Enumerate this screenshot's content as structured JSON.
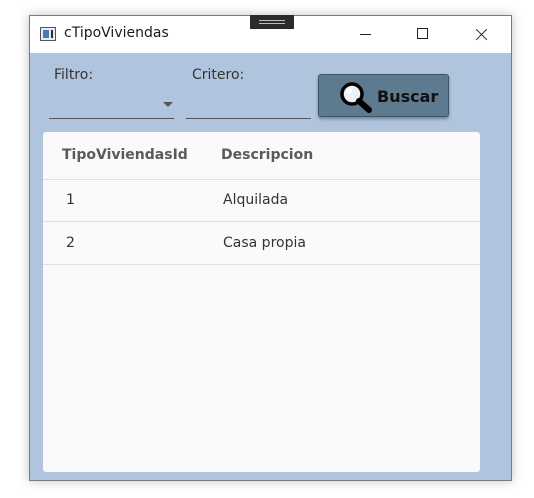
{
  "window": {
    "title": "cTipoViviendas"
  },
  "toolbar": {
    "filtro_label": "Filtro:",
    "filtro_value": "",
    "criterio_label": "Critero:",
    "criterio_value": "",
    "buscar_label": "Buscar",
    "buscar_icon": "search-icon"
  },
  "grid": {
    "columns": [
      "TipoViviendasId",
      "Descripcion"
    ],
    "rows": [
      [
        "1",
        "Alquilada"
      ],
      [
        "2",
        "Casa propia"
      ]
    ]
  },
  "colors": {
    "window_background": "#b0c4de",
    "button_background": "#5e7a8e",
    "grid_background": "#fafafa"
  }
}
